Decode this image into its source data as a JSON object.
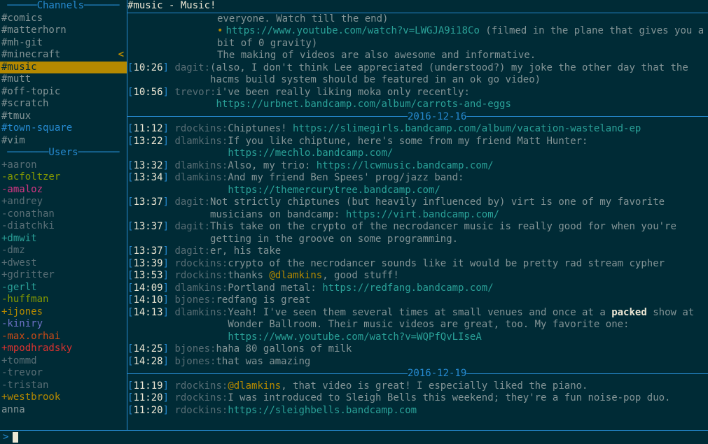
{
  "title": "#music - Music!",
  "section_headers": {
    "channels": "Channels",
    "users": "Users"
  },
  "channels": [
    {
      "name": "#comics",
      "unread": false
    },
    {
      "name": "#matterhorn",
      "unread": false
    },
    {
      "name": "#mh-git",
      "unread": false
    },
    {
      "name": "#minecraft",
      "unread": false,
      "marker": "<"
    },
    {
      "name": "#music",
      "unread": false,
      "active": true
    },
    {
      "name": "#mutt",
      "unread": false
    },
    {
      "name": "#off-topic",
      "unread": false
    },
    {
      "name": "#scratch",
      "unread": false
    },
    {
      "name": "#tmux",
      "unread": false
    },
    {
      "name": "#town-square",
      "unread": true
    },
    {
      "name": "#vim",
      "unread": false
    }
  ],
  "users": [
    {
      "prefix": "+",
      "name": "aaron",
      "color": "#586e75"
    },
    {
      "prefix": "-",
      "name": "acfoltzer",
      "color": "#859900"
    },
    {
      "prefix": "-",
      "name": "amaloz",
      "color": "#d33682"
    },
    {
      "prefix": "+",
      "name": "andrey",
      "color": "#586e75"
    },
    {
      "prefix": "-",
      "name": "conathan",
      "color": "#586e75"
    },
    {
      "prefix": "-",
      "name": "diatchki",
      "color": "#586e75"
    },
    {
      "prefix": "+",
      "name": "dmwit",
      "color": "#2aa198"
    },
    {
      "prefix": "-",
      "name": "dmz",
      "color": "#586e75"
    },
    {
      "prefix": "+",
      "name": "dwest",
      "color": "#586e75"
    },
    {
      "prefix": "+",
      "name": "gdritter",
      "color": "#586e75"
    },
    {
      "prefix": "-",
      "name": "gerlt",
      "color": "#2aa198"
    },
    {
      "prefix": "-",
      "name": "huffman",
      "color": "#859900"
    },
    {
      "prefix": "+",
      "name": "ijones",
      "color": "#b58900"
    },
    {
      "prefix": "-",
      "name": "kiniry",
      "color": "#6c71c4"
    },
    {
      "prefix": "-",
      "name": "max.orhai",
      "color": "#cb4b16"
    },
    {
      "prefix": "+",
      "name": "mpodhradsky",
      "color": "#dc322f"
    },
    {
      "prefix": "+",
      "name": "tommd",
      "color": "#586e75"
    },
    {
      "prefix": "-",
      "name": "trevor",
      "color": "#586e75"
    },
    {
      "prefix": "-",
      "name": "tristan",
      "color": "#586e75"
    },
    {
      "prefix": "+",
      "name": "westbrook",
      "color": "#b58900"
    },
    {
      "prefix": " ",
      "name": "anna",
      "color": "#839496"
    }
  ],
  "prompt": ">",
  "msg": {
    "l0": "everyone. Watch till the end)",
    "l1_url": "https://www.youtube.com/watch?v=LWGJA9i18Co",
    "l1_rest": " (filmed in the plane that gives you a bit of 0 gravity)",
    "l2": "The making of videos are also awesome and informative.",
    "m1_ts": "10:26",
    "m1_nick": "dagit",
    "m1_body": "(also, I don't think Lee appreciated (understood?) my joke the other day that the hacms build system should be featured in an ok go video)",
    "m2_ts": "10:56",
    "m2_nick": "trevor",
    "m2_body": "i've been really liking moka only recently:",
    "m2_url": "https://urbnet.bandcamp.com/album/carrots-and-eggs",
    "date1": "2016-12-16",
    "m3_ts": "11:12",
    "m3_nick": "rdockins",
    "m3_a": "Chiptunes! ",
    "m3_url": "https://slimegirls.bandcamp.com/album/vacation-wasteland-ep",
    "m4_ts": "13:22",
    "m4_nick": "dlamkins",
    "m4_a": "If you like chiptune, here's some from my friend Matt Hunter:",
    "m4_url": "https://mechlo.bandcamp.com/",
    "m5_ts": "13:32",
    "m5_nick": "dlamkins",
    "m5_a": "Also, my trio: ",
    "m5_url": "https://lcwmusic.bandcamp.com/",
    "m6_ts": "13:34",
    "m6_nick": "dlamkins",
    "m6_a": "And my friend Ben Spees' prog/jazz band:",
    "m6_url": "https://themercurytree.bandcamp.com/",
    "m7_ts": "13:37",
    "m7_nick": "dagit",
    "m7_a": "Not strictly chiptunes (but heavily influenced by) virt is one of my favorite musicians on bandcamp: ",
    "m7_url": "https://virt.bandcamp.com/",
    "m8_ts": "13:37",
    "m8_nick": "dagit",
    "m8_a": "This take on the crypto of the necrodancer music is really good for when you're getting in the groove on some programming.",
    "m9_ts": "13:37",
    "m9_nick": "dagit",
    "m9_a": "er, his take",
    "m10_ts": "13:39",
    "m10_nick": "rdockins",
    "m10_a": "crypto of the necrodancer sounds like it would be pretty rad stream cypher",
    "m11_ts": "13:53",
    "m11_nick": "rdockins",
    "m11_a": "thanks ",
    "m11_mention": "@dlamkins",
    "m11_b": ", good stuff!",
    "m12_ts": "14:09",
    "m12_nick": "dlamkins",
    "m12_a": "Portland metal: ",
    "m12_url": "https://redfang.bandcamp.com/",
    "m13_ts": "14:10",
    "m13_nick": "bjones",
    "m13_a": "redfang is great",
    "m14_ts": "14:13",
    "m14_nick": "dlamkins",
    "m14_a": "Yeah! I've seen them several times at small venues and once at a ",
    "m14_bold": "packed",
    "m14_b": " show at Wonder Ballroom. Their music videos are great, too. My favorite one: ",
    "m14_url": "https://www.youtube.com/watch?v=WQPfQvLIseA",
    "m15_ts": "14:25",
    "m15_nick": "bjones",
    "m15_a": "haha 80 gallons of milk",
    "m16_ts": "14:28",
    "m16_nick": "bjones",
    "m16_a": "that was amazing",
    "date2": "2016-12-19",
    "m17_ts": "11:19",
    "m17_nick": "rdockins",
    "m17_mention": "@dlamkins",
    "m17_b": ", that video is great! I especially liked the piano.",
    "m18_ts": "11:20",
    "m18_nick": "rdockins",
    "m18_a": "I was introduced to Sleigh Bells this weekend; they're a fun noise-pop duo.",
    "m19_ts": "11:20",
    "m19_nick": "rdockins",
    "m19_url": "https://sleighbells.bandcamp.com"
  }
}
